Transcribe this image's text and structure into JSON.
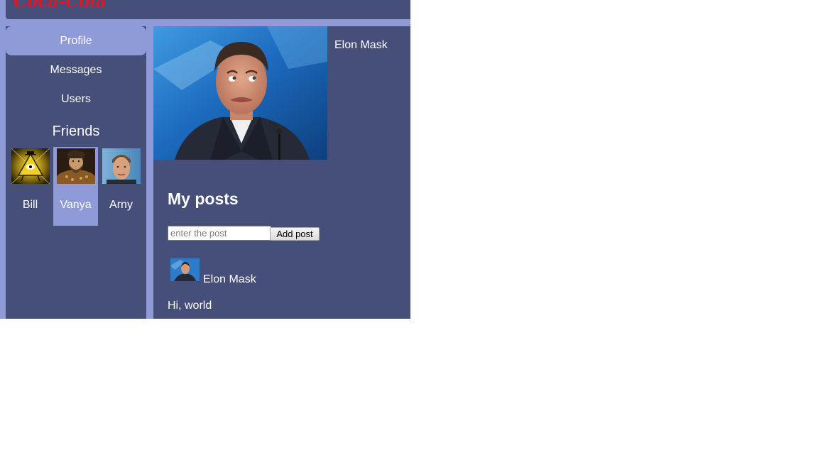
{
  "header": {
    "logo": "Coca-Cola"
  },
  "sidebar": {
    "items": [
      {
        "label": "Profile",
        "active": true
      },
      {
        "label": "Messages",
        "active": false
      },
      {
        "label": "Users",
        "active": false
      }
    ],
    "friends_title": "Friends",
    "friends": [
      {
        "name": "Bill",
        "selected": false
      },
      {
        "name": "Vanya",
        "selected": true
      },
      {
        "name": "Arny",
        "selected": false
      }
    ]
  },
  "profile": {
    "name": "Elon Mask"
  },
  "posts": {
    "title": "My posts",
    "input_placeholder": "enter the post",
    "add_button": "Add post",
    "items": [
      {
        "author": "Elon Mask",
        "text": "Hi, world"
      }
    ]
  },
  "colors": {
    "panel": "#464f7a",
    "accent": "#8f9ad9",
    "logo": "#d61a2a"
  }
}
